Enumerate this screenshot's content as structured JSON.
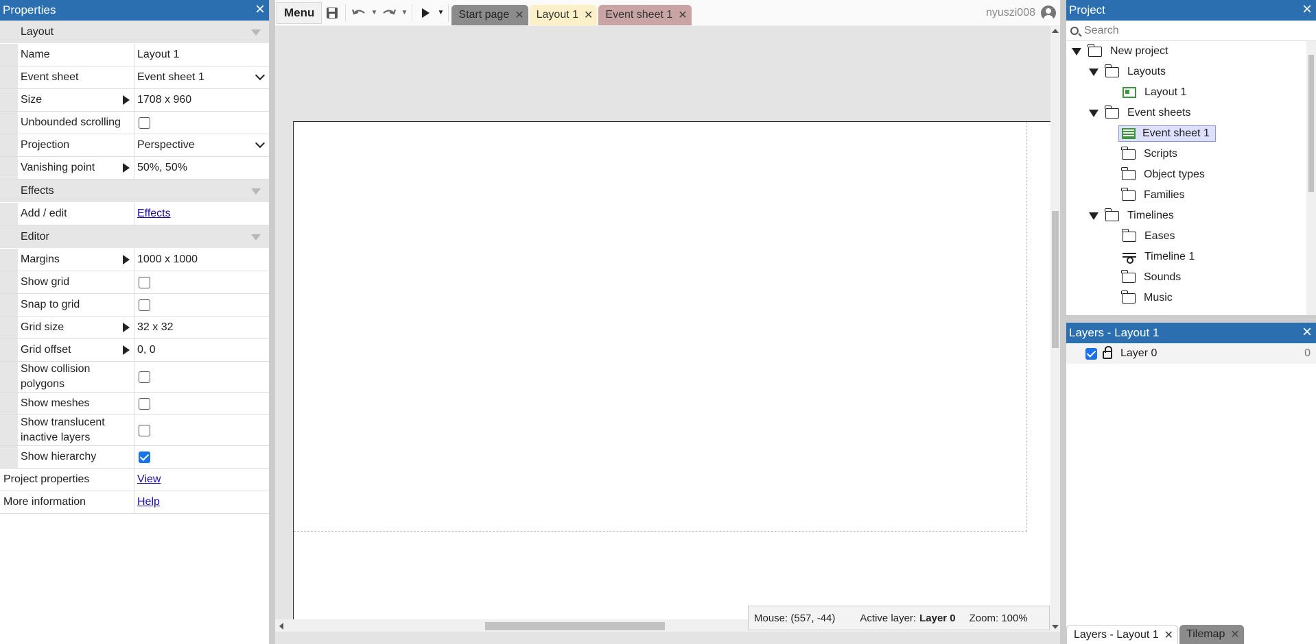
{
  "properties": {
    "title": "Properties",
    "sections": {
      "layout": "Layout",
      "effects": "Effects",
      "editor": "Editor"
    },
    "rows": {
      "name": {
        "label": "Name",
        "value": "Layout 1"
      },
      "event_sheet": {
        "label": "Event sheet",
        "value": "Event sheet 1"
      },
      "size": {
        "label": "Size",
        "value": "1708 x 960"
      },
      "unbounded": {
        "label": "Unbounded scrolling",
        "checked": false
      },
      "projection": {
        "label": "Projection",
        "value": "Perspective"
      },
      "vanishing": {
        "label": "Vanishing point",
        "value": "50%, 50%"
      },
      "add_edit": {
        "label": "Add / edit",
        "link": "Effects"
      },
      "margins": {
        "label": "Margins",
        "value": "1000 x 1000"
      },
      "show_grid": {
        "label": "Show grid",
        "checked": false
      },
      "snap_grid": {
        "label": "Snap to grid",
        "checked": false
      },
      "grid_size": {
        "label": "Grid size",
        "value": "32 x 32"
      },
      "grid_offset": {
        "label": "Grid offset",
        "value": "0, 0"
      },
      "collision": {
        "label": "Show collision polygons",
        "checked": false
      },
      "meshes": {
        "label": "Show meshes",
        "checked": false
      },
      "translucent": {
        "label": "Show translucent inactive layers",
        "checked": false
      },
      "hierarchy": {
        "label": "Show hierarchy",
        "checked": true
      },
      "project_props": {
        "label": "Project properties",
        "link": "View"
      },
      "more_info": {
        "label": "More information",
        "link": "Help"
      }
    }
  },
  "toolbar": {
    "menu": "Menu",
    "tabs": [
      {
        "label": "Start page"
      },
      {
        "label": "Layout 1"
      },
      {
        "label": "Event sheet 1"
      }
    ],
    "user": "nyuszi008"
  },
  "status": {
    "mouse": "Mouse: (557, -44)",
    "active_layer_label": "Active layer:",
    "active_layer": "Layer 0",
    "zoom": "Zoom: 100%"
  },
  "project": {
    "title": "Project",
    "search_placeholder": "Search",
    "tree": {
      "root": "New project",
      "layouts": "Layouts",
      "layout1": "Layout 1",
      "event_sheets": "Event sheets",
      "event_sheet1": "Event sheet 1",
      "scripts": "Scripts",
      "object_types": "Object types",
      "families": "Families",
      "timelines": "Timelines",
      "eases": "Eases",
      "timeline1": "Timeline 1",
      "sounds": "Sounds",
      "music": "Music"
    }
  },
  "layers": {
    "title": "Layers - Layout 1",
    "items": [
      {
        "name": "Layer 0",
        "count": "0"
      }
    ],
    "bottom_tabs": [
      {
        "label": "Layers - Layout 1"
      },
      {
        "label": "Tilemap"
      }
    ]
  },
  "colors": {
    "panel_header": "#2b6fb0",
    "tab_start": "#8b8b8b",
    "tab_layout": "#fcf0c8",
    "tab_event": "#c9a4a4",
    "accent_check": "#1a73e8"
  }
}
